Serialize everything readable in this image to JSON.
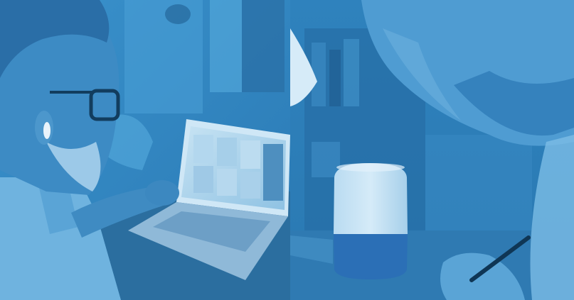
{
  "image": {
    "overlay_color": "#2d86c4",
    "panels": [
      {
        "subject": "man-with-glasses-video-call-laptop"
      },
      {
        "subject": "person-writing-near-smart-speaker"
      }
    ]
  }
}
